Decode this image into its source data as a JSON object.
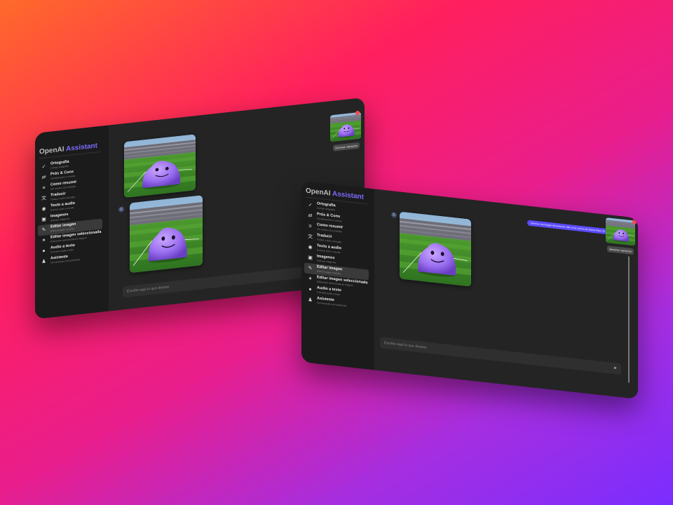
{
  "app": {
    "brand_part1": "OpenAI",
    "brand_part2": "Assistant"
  },
  "sidebar": {
    "items": [
      {
        "label": "Ortografia",
        "sub": "Corrige ortografia",
        "icon": "spellcheck-icon",
        "glyph": "✓"
      },
      {
        "label": "Prós & Cons",
        "sub": "Compara prós e contras",
        "icon": "compare-icon",
        "glyph": "⇄"
      },
      {
        "label": "Como resumir",
        "sub": "Um resumo do conteúdo",
        "icon": "list-icon",
        "glyph": "≡"
      },
      {
        "label": "Traducir",
        "sub": "Traduz o texto colocado",
        "icon": "translate-icon",
        "glyph": "文"
      },
      {
        "label": "Texto a audio",
        "sub": "Escreve texto e escuta",
        "icon": "microphone-icon",
        "glyph": "◉"
      },
      {
        "label": "Imagenes",
        "sub": "Generar imágenes",
        "icon": "image-icon",
        "glyph": "▣"
      },
      {
        "label": "Editar imagen",
        "sub": "Altera imagem enviada",
        "icon": "pencil-icon",
        "glyph": "✎"
      },
      {
        "label": "Editar imagen seleccionada",
        "sub": "Edita parte selecionada da imagem",
        "icon": "magic-wand-icon",
        "glyph": "✶"
      },
      {
        "label": "Audio a texto",
        "sub": "Converte audio a texto",
        "icon": "chat-icon",
        "glyph": "●"
      },
      {
        "label": "Asistente",
        "sub": "Conversação com assistente",
        "icon": "person-icon",
        "glyph": "♟"
      }
    ],
    "active_index": 6
  },
  "chat": {
    "input_placeholder": "Escribe aquí lo que deseas",
    "variation_button": "Generar variación",
    "avatar_letter": "G",
    "user_message": "Generar una imagen del pokemon ditto en la cancha de Stamp Place Ya"
  },
  "colors": {
    "accent": "#7a6bff",
    "bubble": "#5b4bff",
    "sidebar_bg": "#1b1b1b",
    "main_bg": "#242424"
  }
}
